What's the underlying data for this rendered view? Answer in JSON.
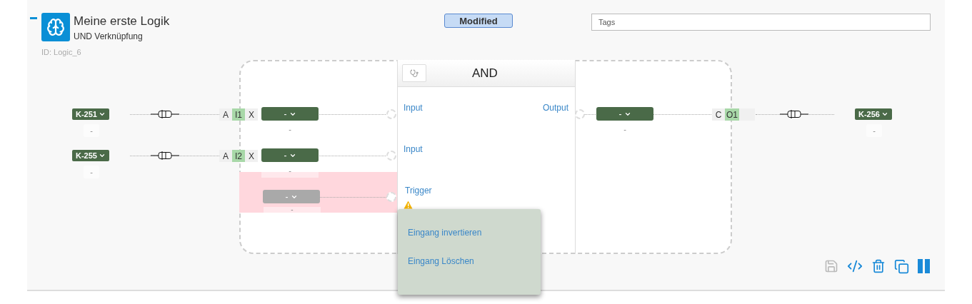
{
  "logic": {
    "title": "Meine erste Logik",
    "subtitle": "UND Verknüpfung",
    "id": "ID: Logic_6",
    "status": "Modified",
    "tags": {
      "placeholder": "Tags"
    }
  },
  "block": {
    "title": "AND"
  },
  "inputs": [
    {
      "kind": "normal",
      "channel": "K-251",
      "channel_value": "-",
      "flags": [
        {
          "label": "A",
          "selected": false
        },
        {
          "label": "I1",
          "selected": true
        },
        {
          "label": "X",
          "selected": false
        }
      ],
      "select": "-",
      "select_value": "-",
      "port_label": "Input"
    },
    {
      "kind": "normal",
      "channel": "K-255",
      "channel_value": "-",
      "flags": [
        {
          "label": "A",
          "selected": false
        },
        {
          "label": "I2",
          "selected": true
        },
        {
          "label": "X",
          "selected": false
        }
      ],
      "select": "-",
      "select_value": "-",
      "port_label": "Input"
    },
    {
      "kind": "trigger",
      "select": "-",
      "select_value": "-",
      "port_label": "Trigger"
    }
  ],
  "output": {
    "port_label": "Output",
    "select": "-",
    "select_value": "-",
    "flags": [
      {
        "label": "C",
        "selected": false
      },
      {
        "label": "O1",
        "selected": true
      }
    ],
    "channel": "K-256",
    "channel_value": "-"
  },
  "menu": {
    "items": [
      "Eingang invertieren",
      "Eingang Löschen"
    ]
  },
  "toolbar": [
    {
      "kind": "save",
      "disabled": true
    },
    {
      "kind": "code",
      "disabled": false
    },
    {
      "kind": "delete",
      "disabled": false
    },
    {
      "kind": "copy",
      "disabled": false
    },
    {
      "kind": "pause",
      "disabled": false
    }
  ]
}
